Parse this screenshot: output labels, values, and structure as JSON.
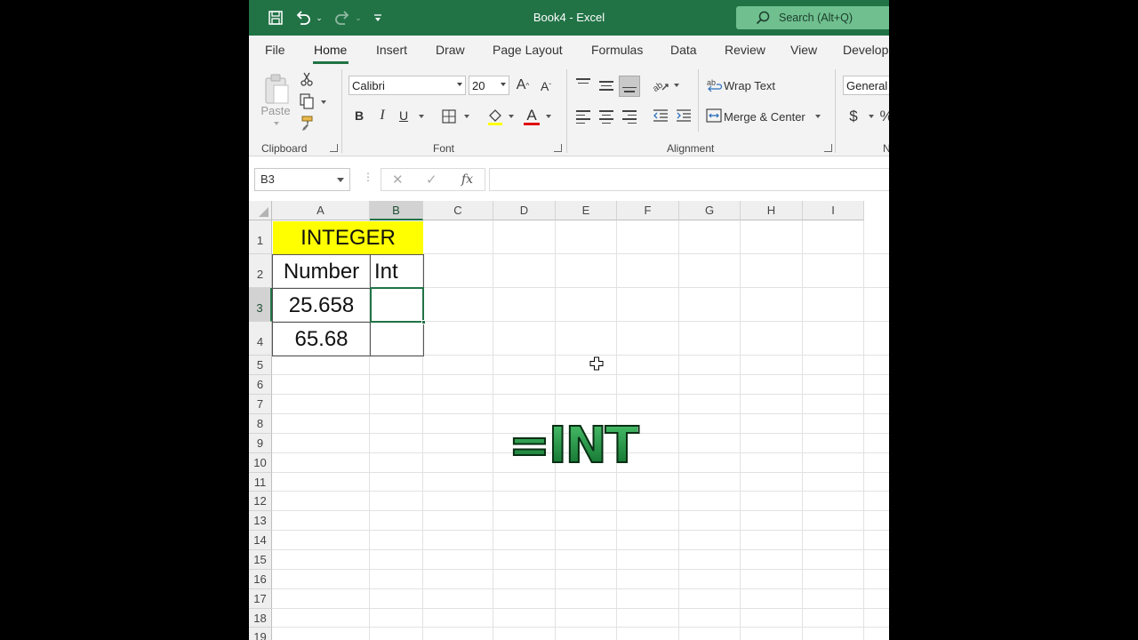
{
  "app": {
    "title": "Book4  -  Excel",
    "search_placeholder": "Search (Alt+Q)",
    "accent_color": "#217346"
  },
  "ribbon_tabs": [
    "File",
    "Home",
    "Insert",
    "Draw",
    "Page Layout",
    "Formulas",
    "Data",
    "Review",
    "View",
    "Develop"
  ],
  "active_tab": "Home",
  "ribbon": {
    "clipboard": {
      "paste_label": "Paste",
      "group_label": "Clipboard"
    },
    "font": {
      "font_name": "Calibri",
      "font_size": "20",
      "group_label": "Font",
      "bold": "B",
      "italic": "I",
      "underline": "U"
    },
    "alignment": {
      "wrap_text": "Wrap Text",
      "merge_center": "Merge & Center",
      "group_label": "Alignment"
    },
    "number": {
      "format": "General",
      "currency": "$",
      "group_label": "N"
    }
  },
  "formula_bar": {
    "name_box": "B3",
    "fx": "fx",
    "formula": ""
  },
  "sheet": {
    "columns": [
      "A",
      "B",
      "C",
      "D",
      "E",
      "F",
      "G",
      "H",
      "I"
    ],
    "selected_column": "B",
    "rows": [
      "1",
      "2",
      "3",
      "4",
      "5",
      "6",
      "7",
      "8",
      "9",
      "10",
      "11",
      "12",
      "13",
      "14",
      "15",
      "16",
      "17",
      "18",
      "19"
    ],
    "selected_row": "3",
    "cells": {
      "A1": "INTEGER",
      "A2": "Number",
      "B2": "Int",
      "A3": "25.658",
      "A4": "65.68"
    },
    "header_fill": "#ffff00"
  },
  "overlay_text": "=INT"
}
